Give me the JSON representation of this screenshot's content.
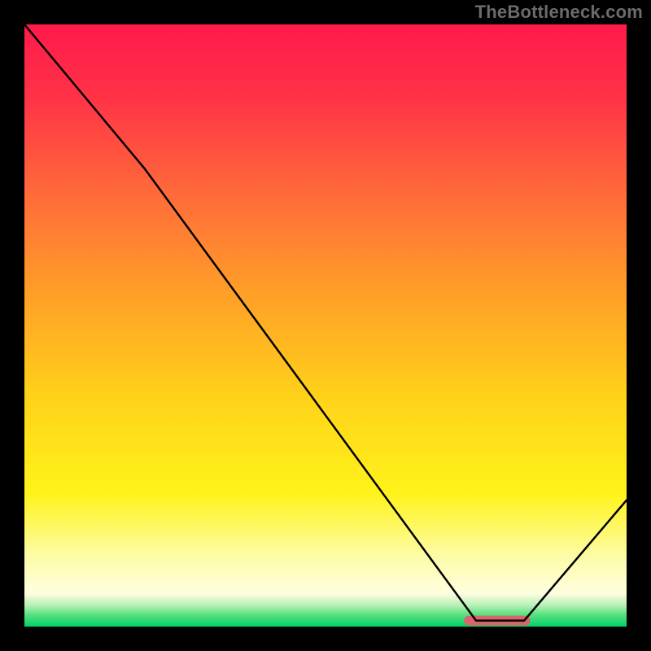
{
  "watermark": "TheBottleneck.com",
  "chart_data": {
    "type": "line",
    "title": "",
    "xlabel": "",
    "ylabel": "",
    "xlim": [
      0,
      100
    ],
    "ylim": [
      0,
      100
    ],
    "grid": false,
    "series": [
      {
        "name": "curve",
        "x": [
          0,
          20,
          75,
          83,
          100
        ],
        "values": [
          100,
          76,
          1,
          1,
          21
        ]
      }
    ],
    "background_gradient": {
      "stops": [
        {
          "offset": 0.0,
          "color": "#ff1a4b"
        },
        {
          "offset": 0.12,
          "color": "#ff3247"
        },
        {
          "offset": 0.28,
          "color": "#ff6a3a"
        },
        {
          "offset": 0.45,
          "color": "#ffa027"
        },
        {
          "offset": 0.62,
          "color": "#ffd21a"
        },
        {
          "offset": 0.78,
          "color": "#fff31a"
        },
        {
          "offset": 0.88,
          "color": "#fdfca3"
        },
        {
          "offset": 0.945,
          "color": "#fefee0"
        },
        {
          "offset": 0.965,
          "color": "#b6f0b5"
        },
        {
          "offset": 0.98,
          "color": "#5ae07f"
        },
        {
          "offset": 1.0,
          "color": "#00d26a"
        }
      ]
    },
    "optimal_bar": {
      "x_start": 73,
      "x_end": 84,
      "y": 1,
      "color": "#d9646c",
      "thickness": 12,
      "corner_radius": 6
    }
  }
}
